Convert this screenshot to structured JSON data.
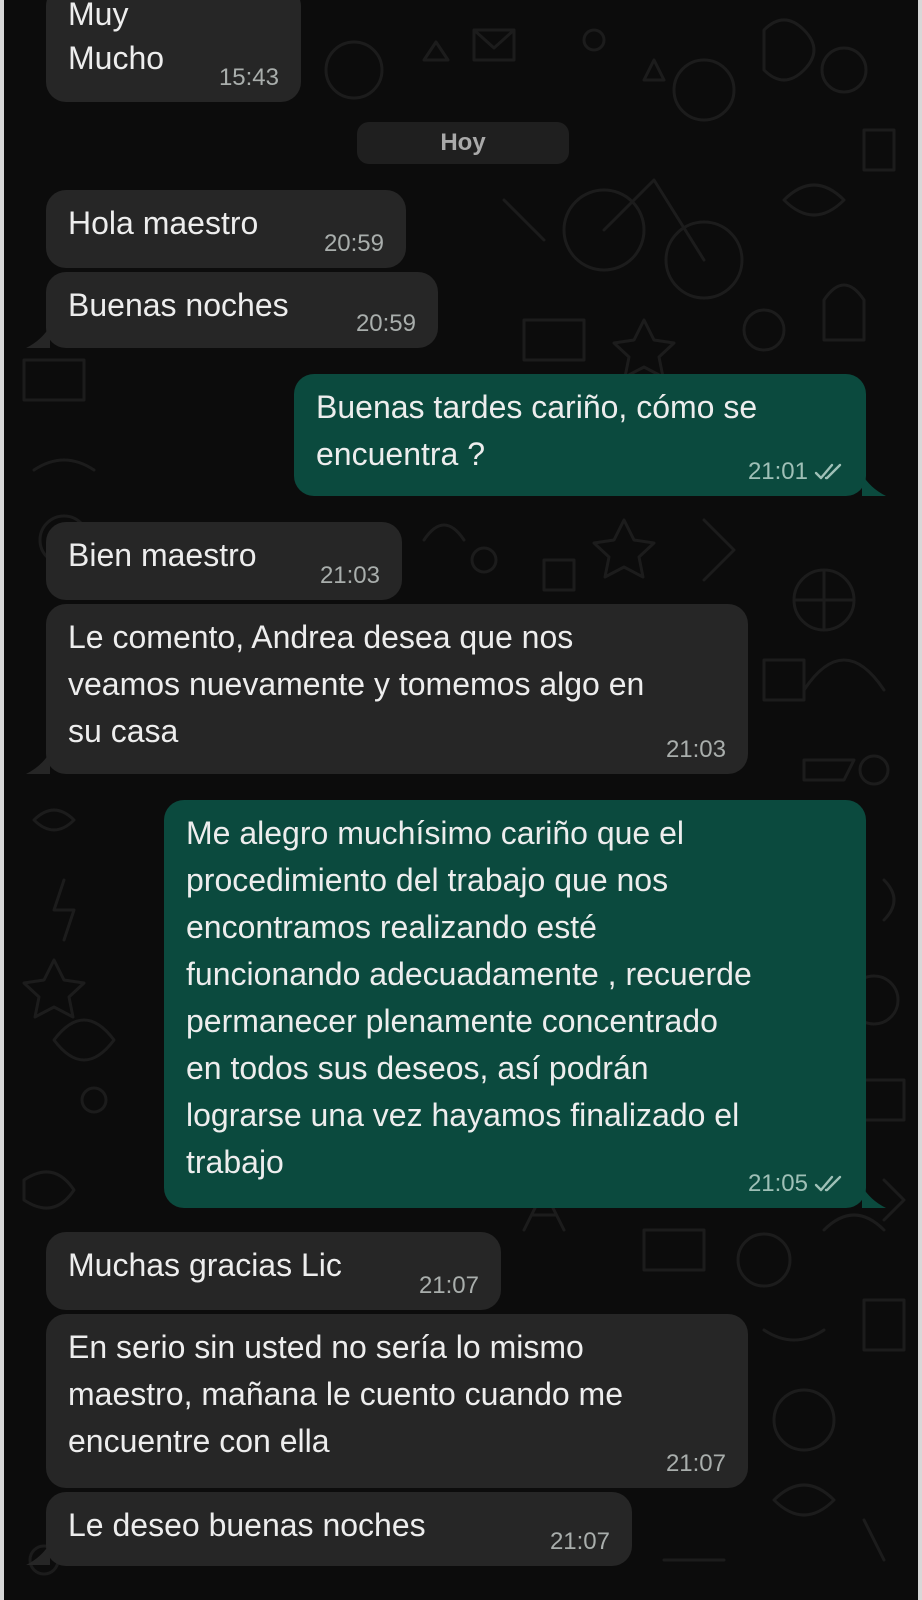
{
  "date_divider": "Hoy",
  "colors": {
    "incoming_bubble": "#262626",
    "outgoing_bubble": "#0b4a3e",
    "chat_background": "#0c0c0c",
    "read_ticks": "#9fc0b7"
  },
  "messages": [
    {
      "direction": "incoming",
      "text": "Muy\nMucho",
      "time": "15:43"
    },
    {
      "direction": "incoming",
      "text": "Hola maestro",
      "time": "20:59"
    },
    {
      "direction": "incoming",
      "text": "Buenas noches",
      "time": "20:59"
    },
    {
      "direction": "outgoing",
      "text": "Buenas tardes cariño, cómo se\nencuentra ?",
      "time": "21:01",
      "status_icon": "double-check-icon"
    },
    {
      "direction": "incoming",
      "text": "Bien maestro",
      "time": "21:03"
    },
    {
      "direction": "incoming",
      "text": "Le comento, Andrea desea que nos\nveamos nuevamente y tomemos algo en\nsu casa",
      "time": "21:03"
    },
    {
      "direction": "outgoing",
      "text": "Me alegro muchísimo cariño que el\nprocedimiento del trabajo que nos\nencontramos realizando esté\nfuncionando adecuadamente , recuerde\npermanecer plenamente concentrado\nen todos sus deseos, así podrán\nlograrse una vez hayamos finalizado el\ntrabajo",
      "time": "21:05",
      "status_icon": "double-check-icon"
    },
    {
      "direction": "incoming",
      "text": "Muchas gracias Lic",
      "time": "21:07"
    },
    {
      "direction": "incoming",
      "text": "En serio sin usted no sería lo mismo\nmaestro, mañana le cuento cuando me\nencuentre con ella",
      "time": "21:07"
    },
    {
      "direction": "incoming",
      "text": "Le deseo buenas noches",
      "time": "21:07"
    }
  ]
}
